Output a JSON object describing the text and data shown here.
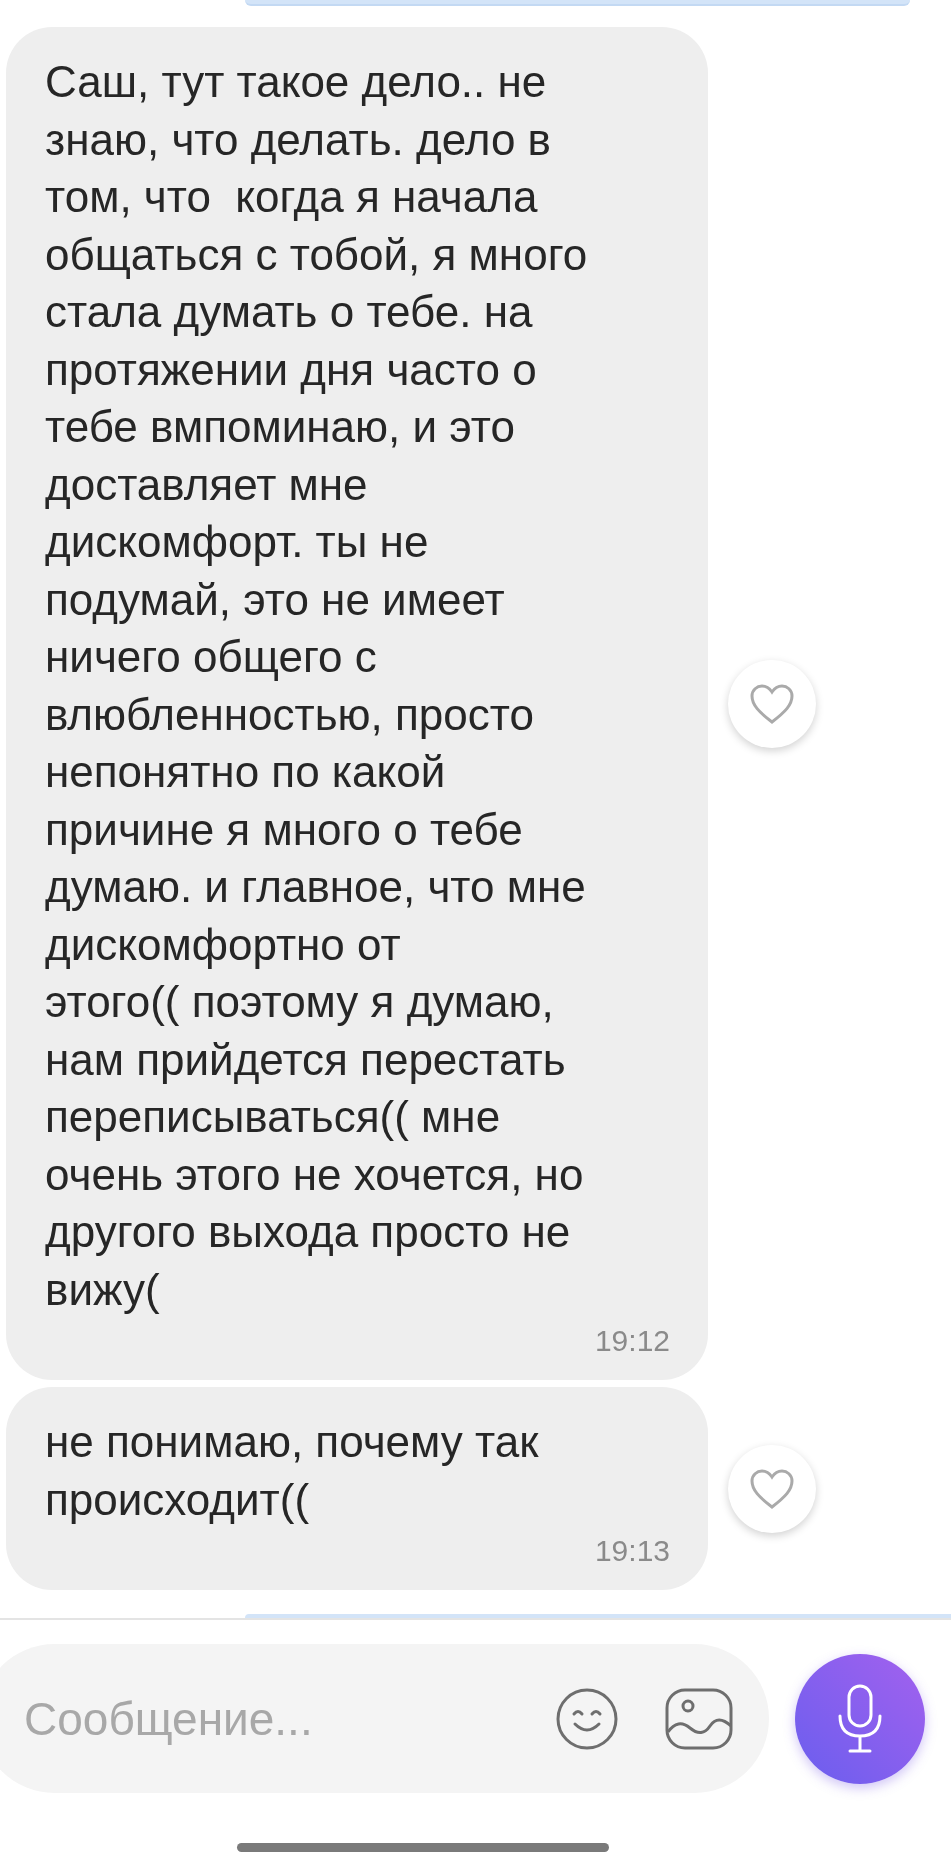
{
  "messages": [
    {
      "text": "Саш, тут такое дело.. не\nзнаю, что делать. дело в\nтом, что  когда я начала\nобщаться с тобой, я много\nстала думать о тебе. на\nпротяжении дня часто о\nтебе вмпоминаю, и это\nдоставляет мне\nдискомфорт. ты не\nподумай, это не имеет\nничего общего с\nвлюбленностью, просто\nнепонятно по какой\nпричине я много о тебе\nдумаю. и главное, что мне\nдискомфортно от\nэтого(( поэтому я думаю,\nнам прийдется перестать\nпереписываться(( мне\nочень этого не хочется, но\nдругого выхода просто не\nвижу(",
      "time": "19:12"
    },
    {
      "text": "не понимаю, почему так\nпроисходит((",
      "time": "19:13"
    }
  ],
  "composer": {
    "placeholder": "Сообщение..."
  }
}
